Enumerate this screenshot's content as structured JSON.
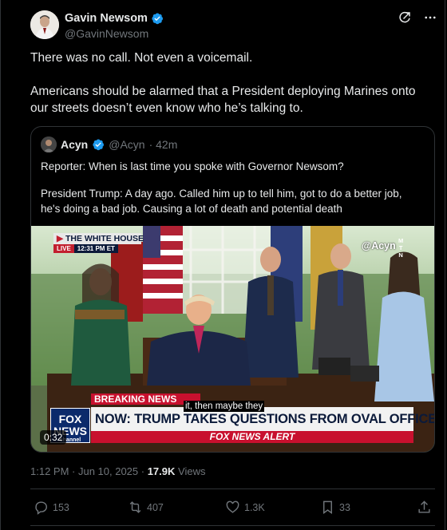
{
  "author": {
    "name": "Gavin Newsom",
    "handle": "@GavinNewsom",
    "verified_color": "#1d9bf0",
    "icons": [
      "grok-icon",
      "more-icon"
    ]
  },
  "tweet": {
    "paragraphs": [
      "There was no call. Not even a voicemail.",
      "Americans should be alarmed that a President deploying Marines onto our streets doesn’t even know who he’s talking to."
    ]
  },
  "quote": {
    "name": "Acyn",
    "handle": "@Acyn",
    "time": "· 42m",
    "paragraphs": [
      "Reporter: When is last time you spoke with Governor Newsom?",
      "President Trump: A day ago. Called him up to tell him, got to do a better job, he's doing a bad job. Causing a lot of death and potential death"
    ],
    "video": {
      "badge_title": "THE WHITE HOUSE",
      "badge_live": "LIVE",
      "badge_time": "12:31 PM ET",
      "watermark": "@Acyn",
      "mtn": [
        "M",
        "T",
        "N"
      ],
      "breaking": "BREAKING NEWS",
      "caption": "it, then maybe they",
      "headline": "NOW: TRUMP TAKES QUESTIONS FROM OVAL OFFICE",
      "alert": "FOX NEWS ALERT",
      "fox_logo": [
        "FOX",
        "NEWS",
        "channel"
      ],
      "duration": "0:32"
    }
  },
  "meta": {
    "time": "1:12 PM · Jun 10, 2025 · ",
    "views_count": "17.9K",
    "views_label": " Views"
  },
  "actions": {
    "replies": "153",
    "reposts": "407",
    "likes": "1.3K",
    "bookmarks": "33"
  },
  "colors": {
    "background": "#000000",
    "text": "#e7e9ea",
    "muted": "#71767b",
    "border": "#2f3336",
    "verified": "#1d9bf0"
  }
}
